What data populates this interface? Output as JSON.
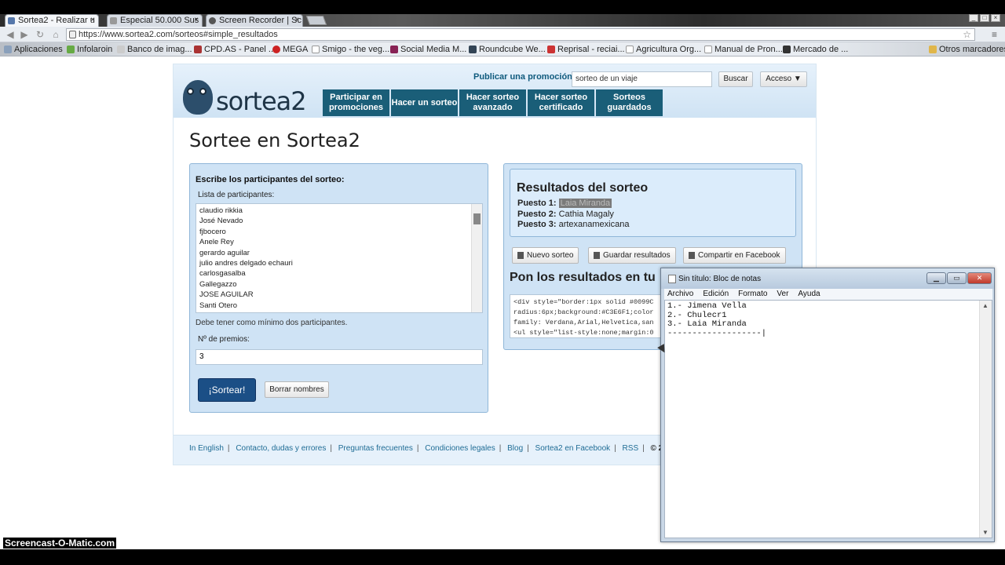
{
  "browser": {
    "tabs": [
      {
        "label": "Sortea2 - Realizar u"
      },
      {
        "label": "Especial 50.000 Sus"
      },
      {
        "label": "Screen Recorder | Sc"
      }
    ],
    "url": "https://www.sortea2.com/sorteos#simple_resultados",
    "bookmarks": [
      "Aplicaciones",
      "Infolaroin",
      "Banco de imag...",
      "CPD.AS - Panel ...",
      "MEGA",
      "Smigo - the veg...",
      "Social Media M...",
      "Roundcube We...",
      "Reprisal - reciai...",
      "Agricultura Org...",
      "Manual de Pron...",
      "Mercado de ...",
      "Otros marcadores"
    ]
  },
  "site": {
    "logo_text": "sortea2",
    "promo_link": "Publicar una promoción",
    "search_value": "sorteo de un viaje",
    "search_button": "Buscar",
    "access_button": "Acceso ▼",
    "nav": [
      "Participar en promociones",
      "Hacer un sorteo",
      "Hacer sorteo avanzado",
      "Hacer sorteo certificado",
      "Sorteos guardados"
    ],
    "page_title": "Sortee en Sortea2"
  },
  "form": {
    "title": "Escribe los participantes del sorteo:",
    "list_label": "Lista de participantes:",
    "participants": [
      "claudio rikkia",
      "José Nevado",
      "fjbocero",
      "Anele Rey",
      "gerardo aguilar",
      "julio andres delgado echauri",
      "carlosgasalba",
      "Gallegazzo",
      "JOSE AGUILAR",
      "Santi Otero"
    ],
    "min_note": "Debe tener como mínimo dos participantes.",
    "prizes_label": "Nº de premios:",
    "prizes_value": "3",
    "sortear_button": "¡Sortear!",
    "borrar_button": "Borrar nombres"
  },
  "results": {
    "title": "Resultados del sorteo",
    "places": [
      {
        "label": "Puesto 1:",
        "name": "Laia Miranda"
      },
      {
        "label": "Puesto 2:",
        "name": "Cathia Magaly"
      },
      {
        "label": "Puesto 3:",
        "name": "artexanamexicana"
      }
    ],
    "new_button": "Nuevo sorteo",
    "save_button": "Guardar resultados",
    "share_button": "Compartir en Facebook",
    "embed_title": "Pon los resultados en tu",
    "embed_code": "<div style=\"border:1px solid #0099C\nradius:6px;background:#C3E6F1;color\nfamily: Verdana,Arial,Helvetica,san\n<ul style=\"list-style:none;margin:0"
  },
  "footer": {
    "links": [
      "In English",
      "Contacto, dudas y errores",
      "Preguntas frecuentes",
      "Condiciones legales",
      "Blog",
      "Sortea2 en Facebook",
      "RSS"
    ],
    "copyright": "© 200"
  },
  "notepad": {
    "title": "Sin título: Bloc de notas",
    "menu": [
      "Archivo",
      "Edición",
      "Formato",
      "Ver",
      "Ayuda"
    ],
    "text": "1.- Jimena Vella\n2.- Chulecr1\n3.- Laia Miranda\n-------------------|"
  },
  "watermark": "Screencast-O-Matic.com"
}
